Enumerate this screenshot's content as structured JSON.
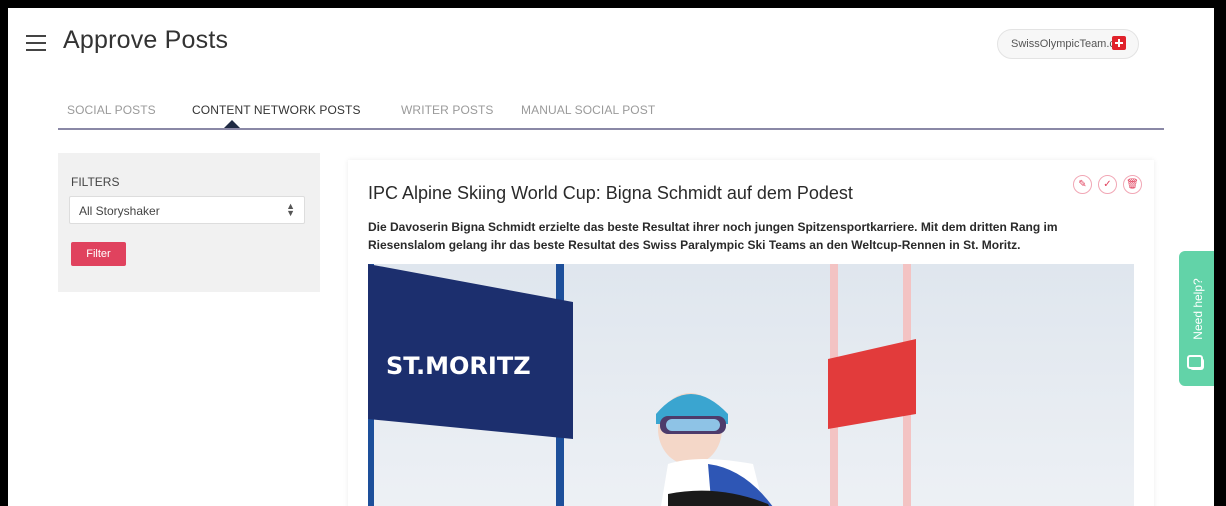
{
  "header": {
    "title": "Approve Posts",
    "site_name": "SwissOlympicTeam.ch"
  },
  "tabs": [
    {
      "label": "SOCIAL POSTS",
      "active": false
    },
    {
      "label": "CONTENT NETWORK POSTS",
      "active": true
    },
    {
      "label": "WRITER POSTS",
      "active": false
    },
    {
      "label": "MANUAL SOCIAL POST",
      "active": false
    }
  ],
  "filters": {
    "label": "FILTERS",
    "select_value": "All Storyshaker",
    "button_label": "Filter"
  },
  "post": {
    "title": "IPC Alpine Skiing World Cup: Bigna Schmidt auf dem Podest",
    "description": "Die Davoserin Bigna Schmidt erzielte das beste Resultat ihrer noch jungen Spitzensportkarriere. Mit dem dritten Rang im Riesenslalom gelang ihr das beste Resultat des Swiss Paralympic Ski Teams an den Weltcup-Rennen in St. Moritz.",
    "banner_text": "ST.MORITZ",
    "actions": [
      "edit-icon",
      "approve-icon",
      "delete-icon"
    ]
  },
  "help": {
    "label": "Need help?"
  },
  "colors": {
    "accent": "#e0425e",
    "tab_underline": "#8a88a6",
    "help": "#62d3a8",
    "banner": "#1c2f6e"
  }
}
